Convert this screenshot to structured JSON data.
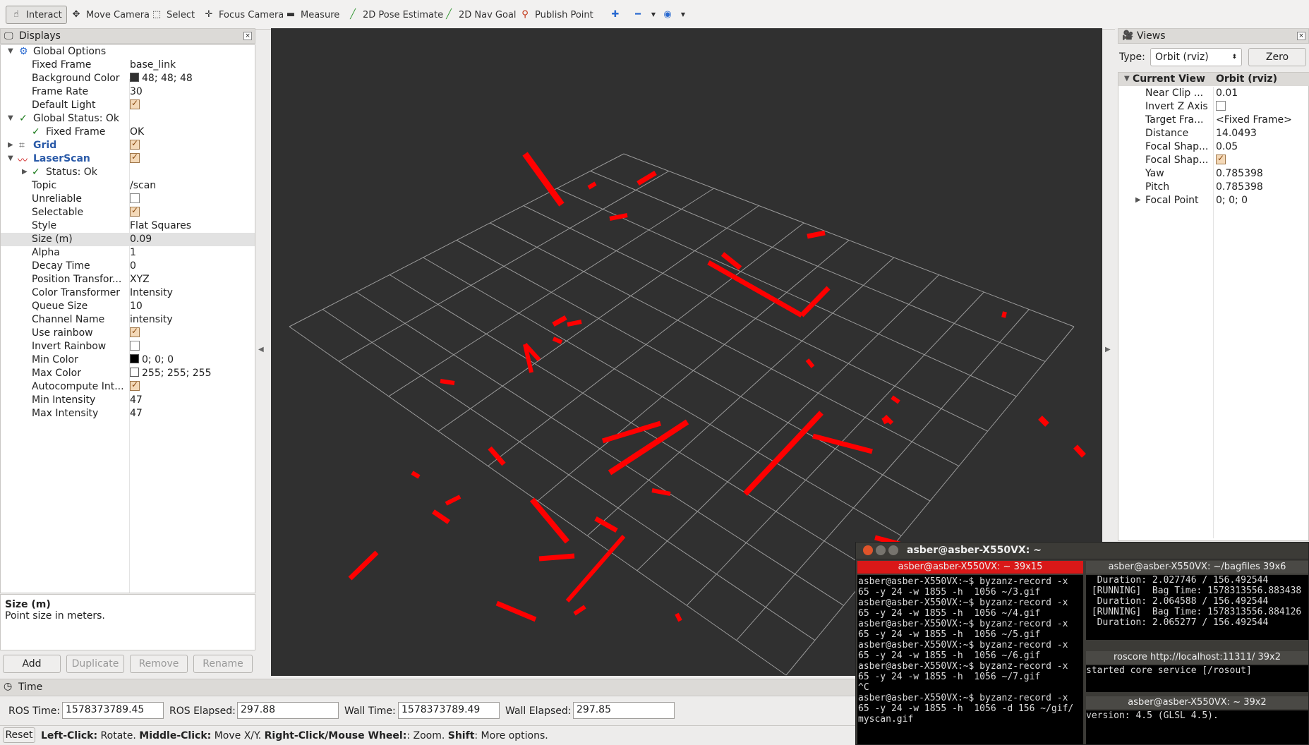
{
  "toolbar": {
    "items": [
      {
        "label": "Interact",
        "icon": "hand-icon"
      },
      {
        "label": "Move Camera",
        "icon": "move-icon"
      },
      {
        "label": "Select",
        "icon": "select-icon"
      },
      {
        "label": "Focus Camera",
        "icon": "focus-icon"
      },
      {
        "label": "Measure",
        "icon": "ruler-icon"
      },
      {
        "label": "2D Pose Estimate",
        "icon": "green-arrow-icon"
      },
      {
        "label": "2D Nav Goal",
        "icon": "green-arrow-icon"
      },
      {
        "label": "Publish Point",
        "icon": "pin-icon"
      }
    ]
  },
  "displays": {
    "title": "Displays",
    "rows": [
      {
        "key": "Global Options",
        "value": ""
      },
      {
        "key": "Fixed Frame",
        "value": "base_link"
      },
      {
        "key": "Background Color",
        "value": "48; 48; 48"
      },
      {
        "key": "Frame Rate",
        "value": "30"
      },
      {
        "key": "Default Light",
        "value": ""
      },
      {
        "key": "Global Status: Ok",
        "value": ""
      },
      {
        "key": "Fixed Frame",
        "value": "OK"
      },
      {
        "key": "Grid",
        "value": ""
      },
      {
        "key": "LaserScan",
        "value": ""
      },
      {
        "key": "Status: Ok",
        "value": ""
      },
      {
        "key": "Topic",
        "value": "/scan"
      },
      {
        "key": "Unreliable",
        "value": ""
      },
      {
        "key": "Selectable",
        "value": ""
      },
      {
        "key": "Style",
        "value": "Flat Squares"
      },
      {
        "key": "Size (m)",
        "value": "0.09"
      },
      {
        "key": "Alpha",
        "value": "1"
      },
      {
        "key": "Decay Time",
        "value": "0"
      },
      {
        "key": "Position Transfor...",
        "value": "XYZ"
      },
      {
        "key": "Color Transformer",
        "value": "Intensity"
      },
      {
        "key": "Queue Size",
        "value": "10"
      },
      {
        "key": "Channel Name",
        "value": "intensity"
      },
      {
        "key": "Use rainbow",
        "value": ""
      },
      {
        "key": "Invert Rainbow",
        "value": ""
      },
      {
        "key": "Min Color",
        "value": "0; 0; 0"
      },
      {
        "key": "Max Color",
        "value": "255; 255; 255"
      },
      {
        "key": "Autocompute Int...",
        "value": ""
      },
      {
        "key": "Min Intensity",
        "value": "47"
      },
      {
        "key": "Max Intensity",
        "value": "47"
      }
    ],
    "desc_title": "Size (m)",
    "desc_text": "Point size in meters.",
    "buttons": {
      "add": "Add",
      "duplicate": "Duplicate",
      "remove": "Remove",
      "rename": "Rename"
    }
  },
  "views": {
    "title": "Views",
    "type_label": "Type:",
    "type_value": "Orbit (rviz)",
    "zero": "Zero",
    "header_key": "Current View",
    "header_value": "Orbit (rviz)",
    "rows": [
      {
        "key": "Near Clip ...",
        "value": "0.01"
      },
      {
        "key": "Invert Z Axis",
        "value": ""
      },
      {
        "key": "Target Fra...",
        "value": "<Fixed Frame>"
      },
      {
        "key": "Distance",
        "value": "14.0493"
      },
      {
        "key": "Focal Shap...",
        "value": "0.05"
      },
      {
        "key": "Focal Shap...",
        "value": ""
      },
      {
        "key": "Yaw",
        "value": "0.785398"
      },
      {
        "key": "Pitch",
        "value": "0.785398"
      },
      {
        "key": "Focal Point",
        "value": "0; 0; 0"
      }
    ]
  },
  "time": {
    "title": "Time",
    "ros_time_label": "ROS Time:",
    "ros_time": "1578373789.45",
    "ros_elapsed_label": "ROS Elapsed:",
    "ros_elapsed": "297.88",
    "wall_time_label": "Wall Time:",
    "wall_time": "1578373789.49",
    "wall_elapsed_label": "Wall Elapsed:",
    "wall_elapsed": "297.85"
  },
  "status": {
    "reset": "Reset",
    "b1": "Left-Click:",
    "t1": " Rotate. ",
    "b2": "Middle-Click:",
    "t2": " Move X/Y. ",
    "b3": "Right-Click/Mouse Wheel:",
    "t3": ": Zoom. ",
    "b4": "Shift",
    "t4": ": More options."
  },
  "terminal": {
    "window_title": "asber@asber-X550VX: ~",
    "pane1_title": "asber@asber-X550VX: ~ 39x15",
    "pane1_text": "asber@asber-X550VX:~$ byzanz-record -x\n65 -y 24 -w 1855 -h  1056 ~/3.gif\nasber@asber-X550VX:~$ byzanz-record -x\n65 -y 24 -w 1855 -h  1056 ~/4.gif\nasber@asber-X550VX:~$ byzanz-record -x\n65 -y 24 -w 1855 -h  1056 ~/5.gif\nasber@asber-X550VX:~$ byzanz-record -x\n65 -y 24 -w 1855 -h  1056 ~/6.gif\nasber@asber-X550VX:~$ byzanz-record -x\n65 -y 24 -w 1855 -h  1056 ~/7.gif\n^C\nasber@asber-X550VX:~$ byzanz-record -x\n65 -y 24 -w 1855 -h  1056 -d 156 ~/gif/\nmyscan.gif",
    "pane2_title": "asber@asber-X550VX: ~/bagfiles 39x6",
    "pane2_text": "  Duration: 2.027746 / 156.492544\n [RUNNING]  Bag Time: 1578313556.883438\n  Duration: 2.064588 / 156.492544\n [RUNNING]  Bag Time: 1578313556.884126\n  Duration: 2.065277 / 156.492544",
    "pane3_title": "roscore http://localhost:11311/ 39x2",
    "pane3_text": "started core service [/rosout]",
    "pane4_title": "asber@asber-X550VX: ~ 39x2",
    "pane4_text": "version: 4.5 (GLSL 4.5)."
  },
  "colors": {
    "viewport_bg": "#303030",
    "laser": "#ff0000",
    "grid": "#a0a0a0"
  }
}
